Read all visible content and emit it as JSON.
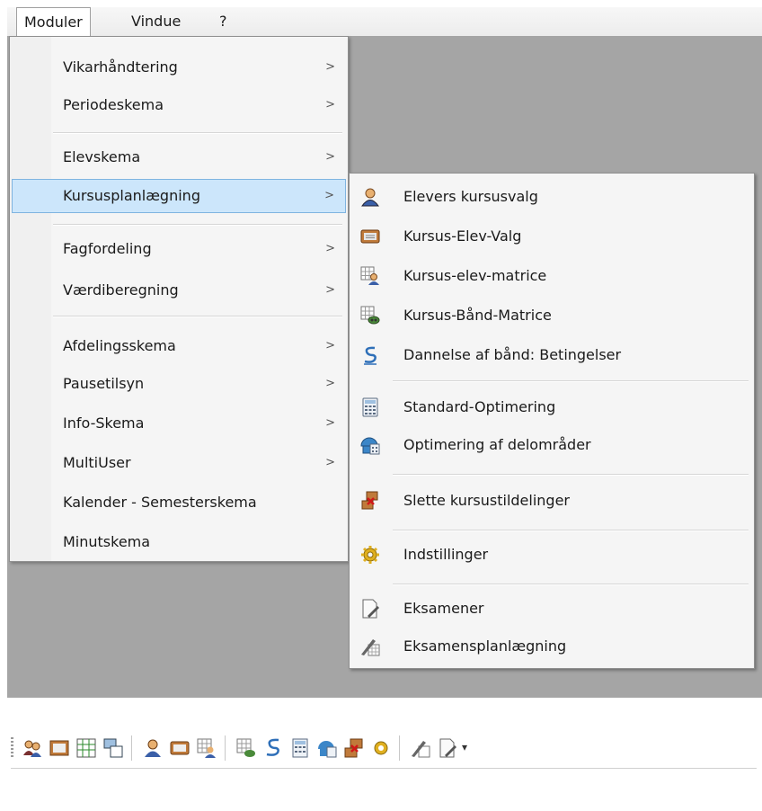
{
  "menubar": {
    "moduler": "Moduler",
    "vindue": "Vindue",
    "help": "?"
  },
  "dropdown": {
    "items": [
      {
        "label": "Vikarhåndtering",
        "arrow": ">"
      },
      {
        "label": "Periodeskema",
        "arrow": ">"
      },
      {
        "label": "Elevskema",
        "arrow": ">"
      },
      {
        "label": "Kursusplanlægning",
        "arrow": ">"
      },
      {
        "label": "Fagfordeling",
        "arrow": ">"
      },
      {
        "label": "Værdiberegning",
        "arrow": ">"
      },
      {
        "label": "Afdelingsskema",
        "arrow": ">"
      },
      {
        "label": "Pausetilsyn",
        "arrow": ">"
      },
      {
        "label": "Info-Skema",
        "arrow": ">"
      },
      {
        "label": "MultiUser",
        "arrow": ">"
      },
      {
        "label": "Kalender - Semesterskema"
      },
      {
        "label": "Minutskema"
      }
    ]
  },
  "submenu": {
    "items": [
      {
        "label": "Elevers kursusvalg",
        "icon": "student-icon"
      },
      {
        "label": "Kursus-Elev-Valg",
        "icon": "course-card-icon"
      },
      {
        "label": "Kursus-elev-matrice",
        "icon": "matrix-student-icon"
      },
      {
        "label": "Kursus-Bånd-Matrice",
        "icon": "matrix-band-icon"
      },
      {
        "label": "Dannelse af bånd: Betingelser",
        "icon": "band-conditions-icon"
      },
      {
        "label": "Standard-Optimering",
        "icon": "calculator-icon"
      },
      {
        "label": "Optimering af delområder",
        "icon": "sub-optimize-icon"
      },
      {
        "label": "Slette kursustildelinger",
        "icon": "delete-assignment-icon"
      },
      {
        "label": "Indstillinger",
        "icon": "settings-gear-icon"
      },
      {
        "label": "Eksamener",
        "icon": "exam-document-icon"
      },
      {
        "label": "Eksamensplanlægning",
        "icon": "exam-planning-icon"
      }
    ]
  },
  "colors": {
    "highlight": "#cce6fb",
    "client_bg": "#a5a5a5"
  }
}
